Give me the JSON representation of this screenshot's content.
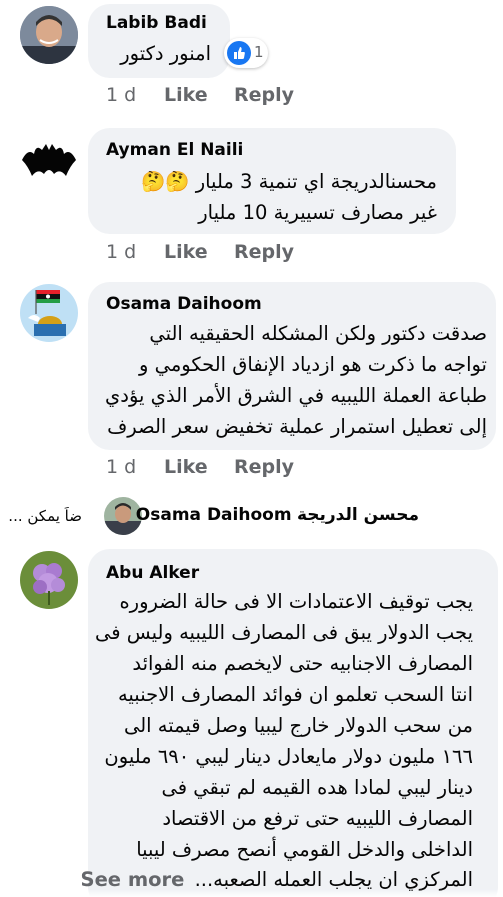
{
  "comments": [
    {
      "author": "Labib Badi",
      "lines": [
        "امنور دكتور"
      ],
      "reaction_count": "1",
      "time": "1 d",
      "like_label": "Like",
      "reply_label": "Reply"
    },
    {
      "author": "Ayman El Naili",
      "lines": [
        "محسنالدريجة اي تنمية 3 مليار 🤔🤔",
        "غير مصارف تسييرية 10 مليار"
      ],
      "time": "1 d",
      "like_label": "Like",
      "reply_label": "Reply"
    },
    {
      "author": "Osama Daihoom",
      "lines": [
        "صدقت دكتور ولكن المشكله الحقيقيه التي",
        "تواجه ما ذكرت هو ازدياد الإنفاق الحكومي و",
        "طباعة العملة الليبيه في الشرق الأمر الذي يؤدي",
        "إلى تعطيل استمرار عملية تخفيض سعر الصرف"
      ],
      "time": "1 d",
      "like_label": "Like",
      "reply_label": "Reply"
    },
    {
      "author": "Abu Alker",
      "lines": [
        "يجب توقيف الاعتمادات الا فى حالة الضروره",
        "يجب الدولار يبق فى المصارف الليبيه وليس فى",
        "المصارف الاجنابيه حتى لايخصم منه الفوائد",
        "انتا السحب تعلمو ان فوائد المصارف الاجنبيه",
        "من سحب الدولار خارج ليبيا  وصل قيمته الى",
        "١٦٦ مليون دولار مايعادل دينار ليبي ٦٩٠ مليون",
        "دينار ليبي لمادا هده القيمه لم تبقي فى",
        "المصارف الليبيه حتى ترفع من الاقتصاد",
        "الداخلى والدخل القومي  أنصح مصرف ليبيا",
        "المركزي ان يجلب العمله الصعبه..."
      ],
      "see_more": "See more"
    }
  ],
  "reply_preview": {
    "name": "Osama Daihoom",
    "mention": "محسن الدريجة",
    "snippet": "ضاً يمكن ..."
  }
}
